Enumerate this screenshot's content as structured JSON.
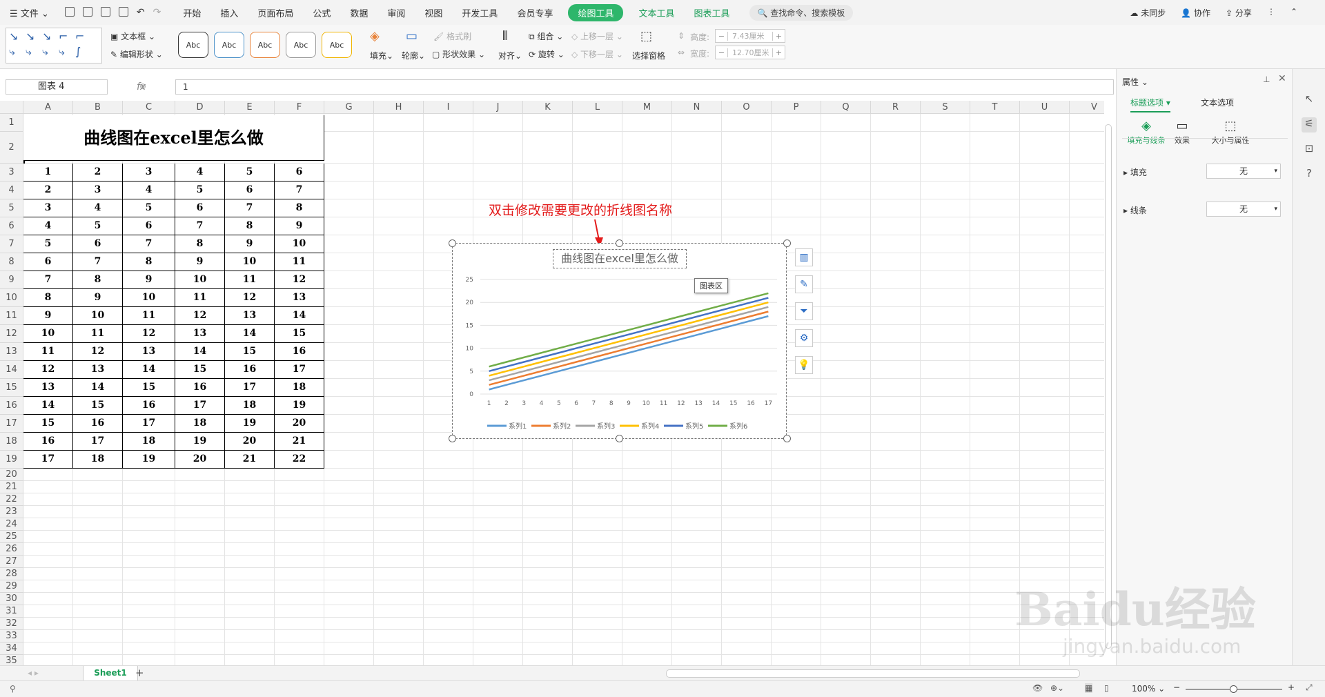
{
  "menubar": {
    "file_label": "文件",
    "tabs": [
      "开始",
      "插入",
      "页面布局",
      "公式",
      "数据",
      "审阅",
      "视图",
      "开发工具",
      "会员专享",
      "绘图工具",
      "文本工具",
      "图表工具"
    ],
    "active_tab": "绘图工具",
    "search_placeholder": "查找命令、搜索模板",
    "sync_label": "未同步",
    "collab_label": "协作",
    "share_label": "分享"
  },
  "ribbon": {
    "textbox_label": "文本框",
    "edit_shape_label": "编辑形状",
    "style_labels": [
      "Abc",
      "Abc",
      "Abc",
      "Abc",
      "Abc"
    ],
    "style_colors": [
      "#333333",
      "#4a90c8",
      "#e8833a",
      "#999999",
      "#f0b400"
    ],
    "fill_label": "填充",
    "outline_label": "轮廓",
    "format_brush_label": "格式刷",
    "shape_effect_label": "形状效果",
    "align_label": "对齐",
    "group_label": "组合",
    "rotate_label": "旋转",
    "up_layer_label": "上移一层",
    "down_layer_label": "下移一层",
    "select_pane_label": "选择窗格",
    "height_label": "高度:",
    "height_value": "7.43厘米",
    "width_label": "宽度:",
    "width_value": "12.70厘米"
  },
  "formula_bar": {
    "name_box": "图表 4",
    "fx": "fx",
    "value": "1"
  },
  "columns": [
    "A",
    "B",
    "C",
    "D",
    "E",
    "F",
    "G",
    "H",
    "I",
    "J",
    "K",
    "L",
    "M",
    "N",
    "O",
    "P",
    "Q",
    "R",
    "S",
    "T",
    "U",
    "V"
  ],
  "rows": [
    "1",
    "2",
    "3",
    "4",
    "5",
    "6",
    "7",
    "8",
    "9",
    "10",
    "11",
    "12",
    "13",
    "14",
    "15",
    "16",
    "17",
    "18",
    "19",
    "20",
    "21",
    "22",
    "23",
    "24",
    "25",
    "26",
    "27",
    "28",
    "29",
    "30",
    "31",
    "32",
    "33",
    "34",
    "35"
  ],
  "table": {
    "title": "曲线图在excel里怎么做",
    "cells": [
      [
        "1",
        "2",
        "3",
        "4",
        "5",
        "6"
      ],
      [
        "2",
        "3",
        "4",
        "5",
        "6",
        "7"
      ],
      [
        "3",
        "4",
        "5",
        "6",
        "7",
        "8"
      ],
      [
        "4",
        "5",
        "6",
        "7",
        "8",
        "9"
      ],
      [
        "5",
        "6",
        "7",
        "8",
        "9",
        "10"
      ],
      [
        "6",
        "7",
        "8",
        "9",
        "10",
        "11"
      ],
      [
        "7",
        "8",
        "9",
        "10",
        "11",
        "12"
      ],
      [
        "8",
        "9",
        "10",
        "11",
        "12",
        "13"
      ],
      [
        "9",
        "10",
        "11",
        "12",
        "13",
        "14"
      ],
      [
        "10",
        "11",
        "12",
        "13",
        "14",
        "15"
      ],
      [
        "11",
        "12",
        "13",
        "14",
        "15",
        "16"
      ],
      [
        "12",
        "13",
        "14",
        "15",
        "16",
        "17"
      ],
      [
        "13",
        "14",
        "15",
        "16",
        "17",
        "18"
      ],
      [
        "14",
        "15",
        "16",
        "17",
        "18",
        "19"
      ],
      [
        "15",
        "16",
        "17",
        "18",
        "19",
        "20"
      ],
      [
        "16",
        "17",
        "18",
        "19",
        "20",
        "21"
      ],
      [
        "17",
        "18",
        "19",
        "20",
        "21",
        "22"
      ]
    ]
  },
  "annotation": "双击修改需要更改的折线图名称",
  "tooltip": "图表区",
  "chart_data": {
    "type": "line",
    "title": "曲线图在excel里怎么做",
    "categories": [
      "1",
      "2",
      "3",
      "4",
      "5",
      "6",
      "7",
      "8",
      "9",
      "10",
      "11",
      "12",
      "13",
      "14",
      "15",
      "16",
      "17"
    ],
    "ylim": [
      0,
      25
    ],
    "yticks": [
      "0",
      "5",
      "10",
      "15",
      "20",
      "25"
    ],
    "grid": true,
    "legend_position": "bottom",
    "series": [
      {
        "name": "系列1",
        "color": "#5b9bd5",
        "values": [
          1,
          2,
          3,
          4,
          5,
          6,
          7,
          8,
          9,
          10,
          11,
          12,
          13,
          14,
          15,
          16,
          17
        ]
      },
      {
        "name": "系列2",
        "color": "#ed7d31",
        "values": [
          2,
          3,
          4,
          5,
          6,
          7,
          8,
          9,
          10,
          11,
          12,
          13,
          14,
          15,
          16,
          17,
          18
        ]
      },
      {
        "name": "系列3",
        "color": "#a5a5a5",
        "values": [
          3,
          4,
          5,
          6,
          7,
          8,
          9,
          10,
          11,
          12,
          13,
          14,
          15,
          16,
          17,
          18,
          19
        ]
      },
      {
        "name": "系列4",
        "color": "#ffc000",
        "values": [
          4,
          5,
          6,
          7,
          8,
          9,
          10,
          11,
          12,
          13,
          14,
          15,
          16,
          17,
          18,
          19,
          20
        ]
      },
      {
        "name": "系列5",
        "color": "#4472c4",
        "values": [
          5,
          6,
          7,
          8,
          9,
          10,
          11,
          12,
          13,
          14,
          15,
          16,
          17,
          18,
          19,
          20,
          21
        ]
      },
      {
        "name": "系列6",
        "color": "#70ad47",
        "values": [
          6,
          7,
          8,
          9,
          10,
          11,
          12,
          13,
          14,
          15,
          16,
          17,
          18,
          19,
          20,
          21,
          22
        ]
      }
    ]
  },
  "side_panel": {
    "title": "属性",
    "tab_title_options": "标题选项",
    "tab_text_options": "文本选项",
    "sub_fill_line": "填充与线条",
    "sub_effect": "效果",
    "sub_size": "大小与属性",
    "fill_label": "填充",
    "fill_value": "无",
    "line_label": "线条",
    "line_value": "无"
  },
  "sheet": {
    "tab_name": "Sheet1",
    "add": "+"
  },
  "status": {
    "zoom": "100%"
  },
  "watermark": {
    "logo": "Baidu经验",
    "url": "jingyan.baidu.com"
  }
}
